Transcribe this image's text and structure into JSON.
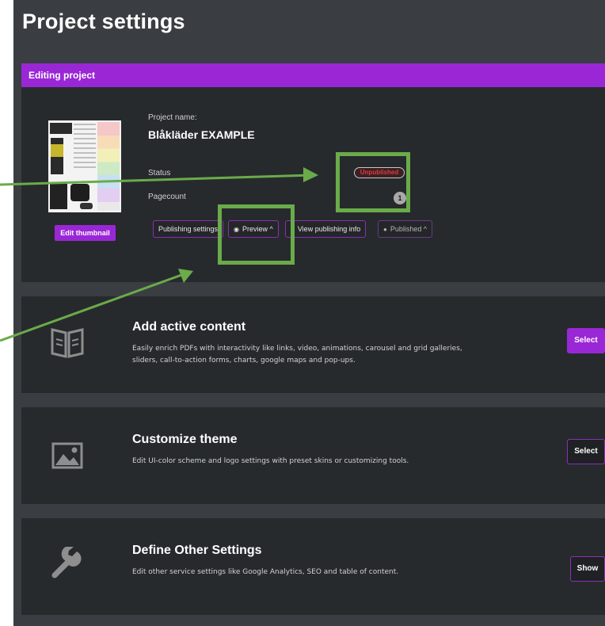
{
  "page": {
    "title": "Project settings"
  },
  "editing_bar": {
    "label": "Editing project"
  },
  "project": {
    "name_label": "Project name:",
    "name": "Blåkläder EXAMPLE",
    "status_label": "Status",
    "status_value": "Unpublished",
    "pagecount_label": "Pagecount",
    "pagecount_value": "1",
    "edit_thumbnail": "Edit thumbnail",
    "buttons": {
      "publishing_settings": "Publishing settings",
      "preview": "Preview ^",
      "view_publishing_info": "View publishing info",
      "published": "Published ^"
    }
  },
  "cards": [
    {
      "icon": "book-icon",
      "title": "Add active content",
      "desc": "Easily enrich PDFs with interactivity like links, video, animations, carousel and grid galleries, sliders, call-to-action forms, charts, google maps and pop-ups.",
      "button": "Select"
    },
    {
      "icon": "image-icon",
      "title": "Customize theme",
      "desc": "Edit UI-color scheme and logo settings with preset skins or customizing tools.",
      "button": "Select"
    },
    {
      "icon": "wrench-icon",
      "title": "Define Other Settings",
      "desc": "Edit other service settings like Google Analytics, SEO and table of content.",
      "button": "Show"
    }
  ],
  "colors": {
    "accent": "#9a27d6",
    "background": "#3a3e42",
    "panel": "#272a2d",
    "annotation": "#6aab4a",
    "status_unpublished": "#e03a3a"
  }
}
